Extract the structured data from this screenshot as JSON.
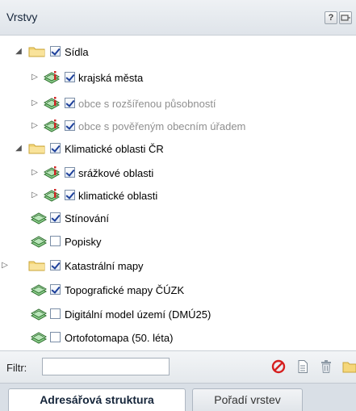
{
  "panel": {
    "title": "Vrstvy",
    "help_icon_label": "?"
  },
  "tree": {
    "sidla": {
      "label": "Sídla",
      "checked": true,
      "expanded": true
    },
    "krajska_mesta": {
      "label": "krajská města",
      "checked": true
    },
    "obce_rozsirenou": {
      "label": "obce s rozšířenou působností",
      "checked": true
    },
    "obce_poverenym": {
      "label": "obce s pověřeným obecním úřadem",
      "checked": true
    },
    "klimaticke": {
      "label": "Klimatické oblasti ČR",
      "checked": true,
      "expanded": true
    },
    "srazkove": {
      "label": "srážkové oblasti",
      "checked": true
    },
    "klim_oblasti": {
      "label": "klimatické oblasti",
      "checked": true
    },
    "stinovani": {
      "label": "Stínování",
      "checked": true
    },
    "popisky": {
      "label": "Popisky",
      "checked": false
    },
    "katastralni": {
      "label": "Katastrální mapy",
      "checked": true,
      "expanded": false
    },
    "topograficke": {
      "label": "Topografické mapy ČÚZK",
      "checked": true
    },
    "dmu25": {
      "label": "Digitální model území (DMÚ25)",
      "checked": false
    },
    "ortofotomapa": {
      "label": "Ortofotomapa (50. léta)",
      "checked": false
    }
  },
  "filter": {
    "label": "Filtr:",
    "value": ""
  },
  "tabs": {
    "structure": "Adresářová struktura",
    "order": "Pořadí vrstev"
  },
  "icons": {
    "expanded": "triangle-down-icon",
    "collapsed": "triangle-right-icon",
    "group": "folder-icon",
    "wms": "wms-layer-icon",
    "info": "info-layer-icon",
    "clear": "no-entry-icon",
    "properties": "document-icon",
    "delete": "trash-icon"
  },
  "colors": {
    "header_bg": "#e3e8ee",
    "folder": "#f2d06b",
    "layer_green": "#3f8e3f",
    "info_red": "#d02525",
    "clear_red": "#d61f1f"
  }
}
